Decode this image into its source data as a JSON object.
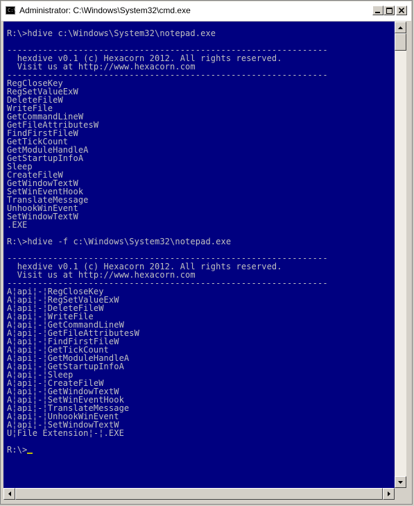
{
  "window": {
    "title": "Administrator: C:\\Windows\\System32\\cmd.exe",
    "icon_label": "C:\\"
  },
  "console": {
    "lines": [
      "R:\\>hdive c:\\Windows\\System32\\notepad.exe",
      "",
      "---------------------------------------------------------------",
      "  hexdive v0.1 (c) Hexacorn 2012. All rights reserved.",
      "  Visit us at http://www.hexacorn.com",
      "---------------------------------------------------------------",
      "RegCloseKey",
      "RegSetValueExW",
      "DeleteFileW",
      "WriteFile",
      "GetCommandLineW",
      "GetFileAttributesW",
      "FindFirstFileW",
      "GetTickCount",
      "GetModuleHandleA",
      "GetStartupInfoA",
      "Sleep",
      "CreateFileW",
      "GetWindowTextW",
      "SetWinEventHook",
      "TranslateMessage",
      "UnhookWinEvent",
      "SetWindowTextW",
      ".EXE",
      "",
      "R:\\>hdive -f c:\\Windows\\System32\\notepad.exe",
      "",
      "---------------------------------------------------------------",
      "  hexdive v0.1 (c) Hexacorn 2012. All rights reserved.",
      "  Visit us at http://www.hexacorn.com",
      "---------------------------------------------------------------",
      "A¦api¦-¦RegCloseKey",
      "A¦api¦-¦RegSetValueExW",
      "A¦api¦-¦DeleteFileW",
      "A¦api¦-¦WriteFile",
      "A¦api¦-¦GetCommandLineW",
      "A¦api¦-¦GetFileAttributesW",
      "A¦api¦-¦FindFirstFileW",
      "A¦api¦-¦GetTickCount",
      "A¦api¦-¦GetModuleHandleA",
      "A¦api¦-¦GetStartupInfoA",
      "A¦api¦-¦Sleep",
      "A¦api¦-¦CreateFileW",
      "A¦api¦-¦GetWindowTextW",
      "A¦api¦-¦SetWinEventHook",
      "A¦api¦-¦TranslateMessage",
      "A¦api¦-¦UnhookWinEvent",
      "A¦api¦-¦SetWindowTextW",
      "U¦File Extension¦-¦.EXE",
      ""
    ],
    "prompt": "R:\\>"
  },
  "icons": {
    "minimize": "minimize-icon",
    "maximize": "maximize-icon",
    "close": "close-icon",
    "scroll_up": "arrow-up-icon",
    "scroll_down": "arrow-down-icon",
    "scroll_left": "arrow-left-icon",
    "scroll_right": "arrow-right-icon"
  },
  "colors": {
    "console_bg": "#000080",
    "console_fg": "#c0c0c0",
    "cursor": "#c0c000"
  }
}
